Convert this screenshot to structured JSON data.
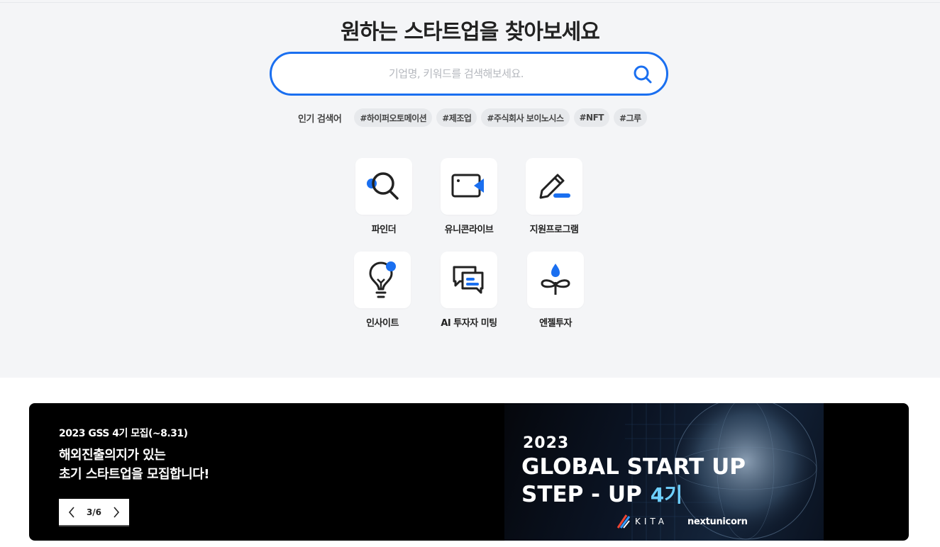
{
  "hero": {
    "title": "원하는 스타트업을 찾아보세요",
    "search_placeholder": "기업명, 키워드를 검색해보세요.",
    "popular_label": "인기 검색어",
    "popular_tags": [
      "#하이퍼오토메이션",
      "#제조업",
      "#주식회사 보이노시스",
      "#NFT",
      "#그루"
    ]
  },
  "menu": [
    {
      "label": "파인더",
      "icon": "search-icon"
    },
    {
      "label": "유니콘라이브",
      "icon": "video-camera-icon"
    },
    {
      "label": "지원프로그램",
      "icon": "pencil-icon"
    },
    {
      "label": "인사이트",
      "icon": "lightbulb-icon"
    },
    {
      "label": "AI 투자자 미팅",
      "icon": "chat-bubbles-icon"
    },
    {
      "label": "엔젤투자",
      "icon": "sprout-icon"
    }
  ],
  "banner": {
    "subtitle": "2023 GSS 4기 모집(~8.31)",
    "headline_line1": "해외진출의지가 있는",
    "headline_line2": "초기 스타트업을 모집합니다!",
    "pager": "3/6",
    "image_year": "2023",
    "image_line1": "GLOBAL START UP",
    "image_line2": "STEP - UP",
    "image_gen": "4기",
    "logo_kita": "KITA",
    "logo_partner": "nextunicorn"
  },
  "colors": {
    "accent": "#1a6ff0",
    "hero_bg": "#f4f5f7",
    "banner_bg": "#000000"
  }
}
